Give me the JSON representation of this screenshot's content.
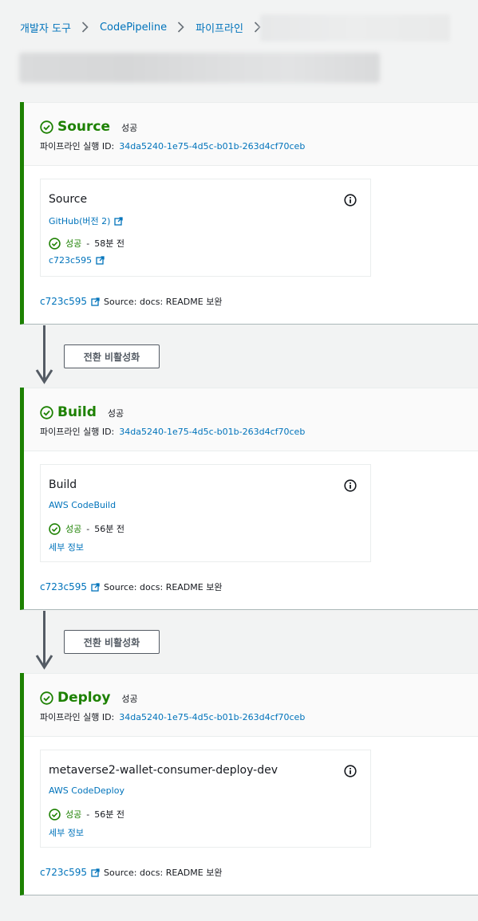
{
  "breadcrumb": {
    "items": [
      "개발자 도구",
      "CodePipeline",
      "파이프라인"
    ]
  },
  "colors": {
    "success": "#1d8102",
    "link": "#0073bb",
    "stage_border": "#1d8102"
  },
  "stages": [
    {
      "name": "Source",
      "status": "성공",
      "exec_label": "파이프라인 실행 ID:",
      "exec_id": "34da5240-1e75-4d5c-b01b-263d4cf70ceb",
      "action": {
        "name": "Source",
        "provider": "GitHub(버전 2)",
        "status": "성공",
        "time": "58분 전",
        "detail": "c723c595"
      },
      "commit_id": "c723c595",
      "commit_msg": "Source: docs: README 보완"
    },
    {
      "name": "Build",
      "status": "성공",
      "exec_label": "파이프라인 실행 ID:",
      "exec_id": "34da5240-1e75-4d5c-b01b-263d4cf70ceb",
      "action": {
        "name": "Build",
        "provider": "AWS CodeBuild",
        "status": "성공",
        "time": "56분 전",
        "detail": "세부 정보"
      },
      "commit_id": "c723c595",
      "commit_msg": "Source: docs: README 보완"
    },
    {
      "name": "Deploy",
      "status": "성공",
      "exec_label": "파이프라인 실행 ID:",
      "exec_id": "34da5240-1e75-4d5c-b01b-263d4cf70ceb",
      "action": {
        "name": "metaverse2-wallet-consumer-deploy-dev",
        "provider": "AWS CodeDeploy",
        "status": "성공",
        "time": "56분 전",
        "detail": "세부 정보"
      },
      "commit_id": "c723c595",
      "commit_msg": "Source: docs: README 보완"
    }
  ],
  "transitions": [
    {
      "button_label": "전환 비활성화"
    },
    {
      "button_label": "전환 비활성화"
    }
  ]
}
